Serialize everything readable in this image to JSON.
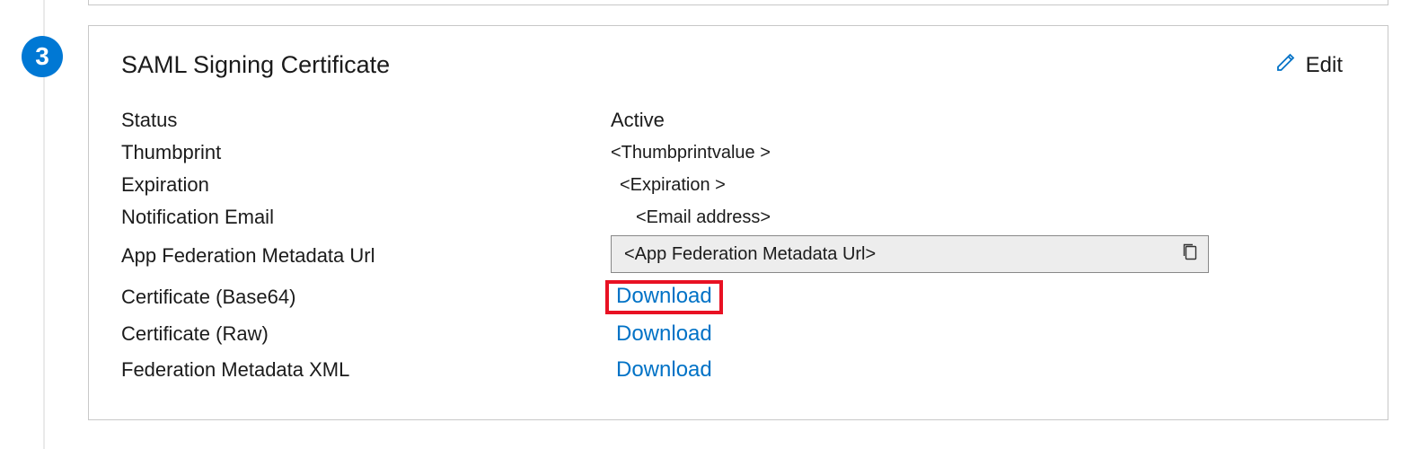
{
  "step": "3",
  "card": {
    "title": "SAML Signing Certificate",
    "edit_label": "Edit",
    "rows": {
      "status": {
        "label": "Status",
        "value": "Active"
      },
      "thumbprint": {
        "label": "Thumbprint",
        "value": "<Thumbprintvalue >"
      },
      "expiration": {
        "label": "Expiration",
        "value": "<Expiration >"
      },
      "notification_email": {
        "label": "Notification Email",
        "value": "<Email address>"
      },
      "metadata_url": {
        "label": "App Federation Metadata Url",
        "value": "<App Federation  Metadata Url>"
      },
      "cert_base64": {
        "label": "Certificate (Base64)",
        "action": "Download"
      },
      "cert_raw": {
        "label": "Certificate (Raw)",
        "action": "Download"
      },
      "fed_xml": {
        "label": "Federation Metadata XML",
        "action": "Download"
      }
    }
  }
}
